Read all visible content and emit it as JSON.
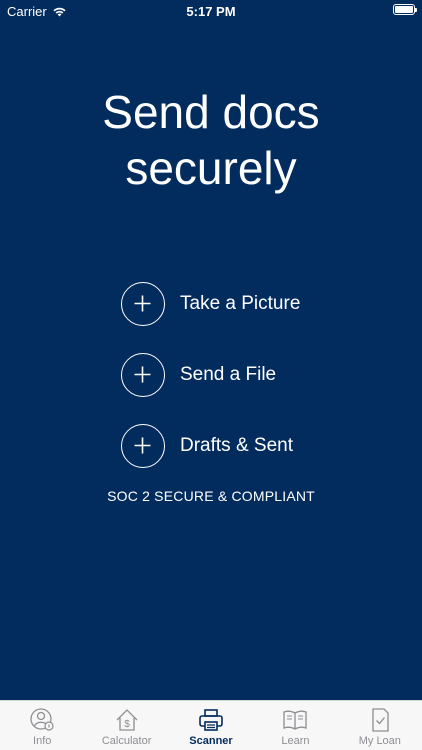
{
  "status_bar": {
    "carrier": "Carrier",
    "time": "5:17 PM",
    "icons": [
      "wifi-icon",
      "battery-icon"
    ]
  },
  "main": {
    "title_line1": "Send docs",
    "title_line2": "securely",
    "actions": [
      {
        "label": "Take a Picture",
        "icon": "plus-circle-icon"
      },
      {
        "label": "Send a File",
        "icon": "plus-circle-icon"
      },
      {
        "label": "Drafts & Sent",
        "icon": "plus-circle-icon"
      }
    ],
    "compliance": "SOC 2 SECURE & COMPLIANT"
  },
  "tab_bar": {
    "active": "Scanner",
    "tabs": [
      {
        "label": "Info",
        "icon": "user-info-icon"
      },
      {
        "label": "Calculator",
        "icon": "house-dollar-icon"
      },
      {
        "label": "Scanner",
        "icon": "printer-icon"
      },
      {
        "label": "Learn",
        "icon": "book-icon"
      },
      {
        "label": "My Loan",
        "icon": "checked-document-icon"
      }
    ]
  },
  "colors": {
    "background": "#032c5e",
    "text": "#ffffff",
    "tab_bar_bg": "#f7f7f7",
    "tab_inactive": "#8e8e93",
    "tab_active": "#032c5e"
  }
}
